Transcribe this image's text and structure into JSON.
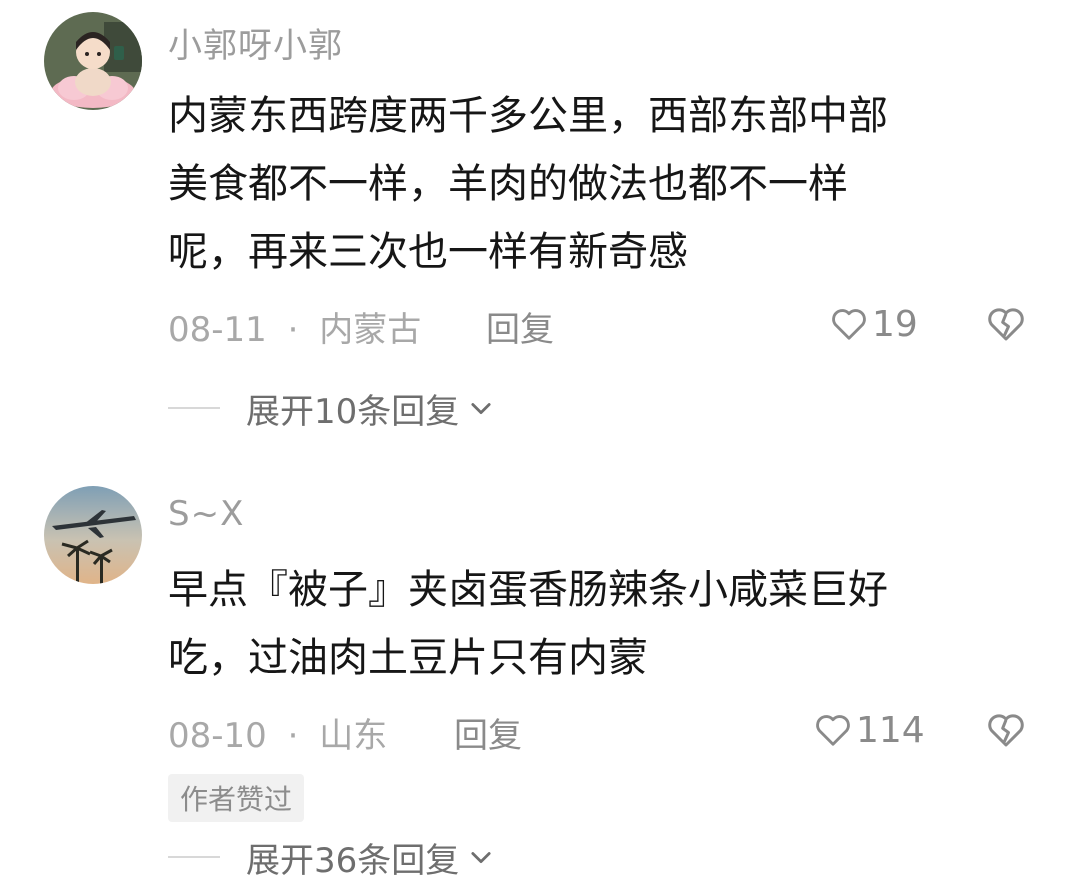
{
  "comments": [
    {
      "username": "小郭呀小郭",
      "text_lines": [
        "内蒙东西跨度两千多公里，西部东部中部",
        "美食都不一样，羊肉的做法也都不一样",
        "呢，再来三次也一样有新奇感"
      ],
      "date": "08-11",
      "sep": "·",
      "location": "内蒙古",
      "reply_label": "回复",
      "likes": "19",
      "expand_label": "展开10条回复",
      "avatar_icon": "girl-on-lotus-avatar"
    },
    {
      "username": "S~X",
      "text_lines": [
        "早点『被子』夹卤蛋香肠辣条小咸菜巨好",
        "吃，过油肉土豆片只有内蒙"
      ],
      "date": "08-10",
      "sep": "·",
      "location": "山东",
      "reply_label": "回复",
      "likes": "114",
      "badge": "作者赞过",
      "expand_label": "展开36条回复",
      "avatar_icon": "airplane-palm-avatar"
    }
  ],
  "icons": {
    "like": "heart-outline-icon",
    "dislike": "broken-heart-icon",
    "expand": "chevron-down-icon"
  },
  "colors": {
    "text": "#161616",
    "muted": "#9c9c9c",
    "badge_bg": "#f1f1f1"
  }
}
